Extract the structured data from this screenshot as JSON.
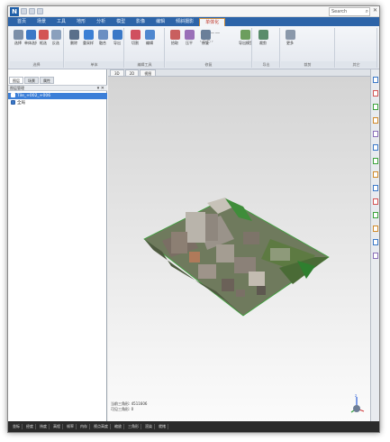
{
  "app": {
    "logo_text": "N",
    "window_title": "",
    "search_placeholder": "Search"
  },
  "ribbon_tabs": [
    {
      "label": "首页",
      "active": false
    },
    {
      "label": "场景",
      "active": false
    },
    {
      "label": "工具",
      "active": false
    },
    {
      "label": "地形",
      "active": false
    },
    {
      "label": "分析",
      "active": false
    },
    {
      "label": "模型",
      "active": false
    },
    {
      "label": "影像",
      "active": false
    },
    {
      "label": "编辑",
      "active": false
    },
    {
      "label": "倾斜摄影",
      "active": false
    },
    {
      "label": "单体化",
      "active": true
    }
  ],
  "ribbon_groups": [
    {
      "label": "选择"
    },
    {
      "label": "单体"
    },
    {
      "label": "编辑工具"
    },
    {
      "label": "修复"
    },
    {
      "label": "导出"
    },
    {
      "label": "裁剪"
    },
    {
      "label": "其它"
    }
  ],
  "ribbon_buttons": [
    {
      "label": "选择",
      "icon": "cursor-icon",
      "color": "#7c8fa8"
    },
    {
      "label": "单体选择",
      "icon": "select-icon",
      "color": "#3a78c7"
    },
    {
      "label": "框选",
      "icon": "box-select-icon",
      "color": "#d35454"
    },
    {
      "label": "反选",
      "icon": "invert-icon",
      "color": "#8aa0bd"
    },
    {
      "label": "删除",
      "icon": "delete-icon",
      "color": "#5a6f8a"
    },
    {
      "label": "重采样",
      "icon": "resample-icon",
      "color": "#3b7fd4"
    },
    {
      "label": "融合",
      "icon": "merge-icon",
      "color": "#6b8fc2"
    },
    {
      "label": "导出",
      "icon": "export-icon",
      "color": "#3a78c7"
    },
    {
      "label": "切割",
      "icon": "cut-icon",
      "color": "#d0505f"
    },
    {
      "label": "编辑",
      "icon": "edit-icon",
      "color": "#4f87cf"
    },
    {
      "label": "拾取",
      "icon": "pick-icon",
      "color": "#c95f5f"
    },
    {
      "label": "压平",
      "icon": "flatten-icon",
      "color": "#9a6fb8"
    },
    {
      "label": "修复",
      "icon": "repair-icon",
      "color": "#6a7f99"
    },
    {
      "label": "导出模型",
      "icon": "export-model-icon",
      "color": "#6c9e5d"
    },
    {
      "label": "裁剪",
      "icon": "crop-icon",
      "color": "#5a8d6b"
    },
    {
      "label": "更多",
      "icon": "more-icon",
      "color": "#8a98aa"
    }
  ],
  "panel": {
    "tabs": [
      "图层",
      "场景",
      "属性"
    ],
    "header": "图层管理",
    "tree": [
      {
        "label": "Tile_+002_+006",
        "selected": true,
        "icon": "layer-icon",
        "color": "#ffffff"
      },
      {
        "label": "全局",
        "selected": false,
        "icon": "globe-icon",
        "color": "#3a78c7"
      }
    ]
  },
  "doc_tabs": [
    "3D",
    "2D",
    "视图"
  ],
  "view_info": {
    "line1": "当前三角形: 4511606",
    "line2": "可见三角形: 0"
  },
  "statusbar": [
    "坐标",
    "经度",
    "纬度",
    "高程",
    "帧率",
    "内存",
    "视点高度",
    "缩放",
    "三角形",
    "渲染",
    "就绪"
  ],
  "colors": {
    "ribbon_tab_bar": "#2d64a8",
    "selection": "#3c7fd8",
    "status_bar": "#2b2b2b",
    "model_edge": "#3ca33c"
  }
}
